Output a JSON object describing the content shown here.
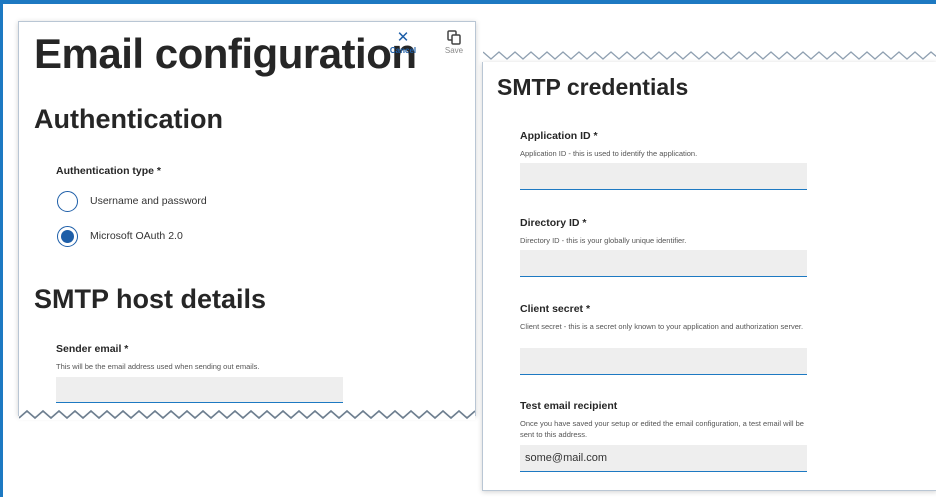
{
  "left": {
    "title": "Email configuration",
    "toolbar": {
      "cancel_label": "Cancel",
      "save_label": "Save"
    },
    "authentication": {
      "heading": "Authentication",
      "type_label": "Authentication type *",
      "options": [
        {
          "label": "Username and password",
          "selected": false
        },
        {
          "label": "Microsoft OAuth 2.0",
          "selected": true
        }
      ]
    },
    "smtp_host": {
      "heading": "SMTP host details",
      "sender_label": "Sender email *",
      "sender_help": "This will be the email address used when sending out emails.",
      "sender_value": ""
    }
  },
  "right": {
    "heading": "SMTP credentials",
    "fields": [
      {
        "label": "Application ID *",
        "help": "Application ID - this is used to identify the application.",
        "value": ""
      },
      {
        "label": "Directory ID *",
        "help": "Directory ID - this is your globally unique identifier.",
        "value": ""
      },
      {
        "label": "Client secret *",
        "help": "Client secret - this is a secret only known to your application and authorization server.",
        "value": ""
      },
      {
        "label": "Test email recipient",
        "help": "Once you have saved your setup or edited the email configuration, a test email will be sent to this address.",
        "value": "some@mail.com"
      }
    ]
  },
  "icons": {
    "cancel": "close-icon",
    "save": "save-icon"
  },
  "colors": {
    "accent": "#1d79c2",
    "primary": "#1d5ea8",
    "input_bg": "#eeeeee"
  }
}
